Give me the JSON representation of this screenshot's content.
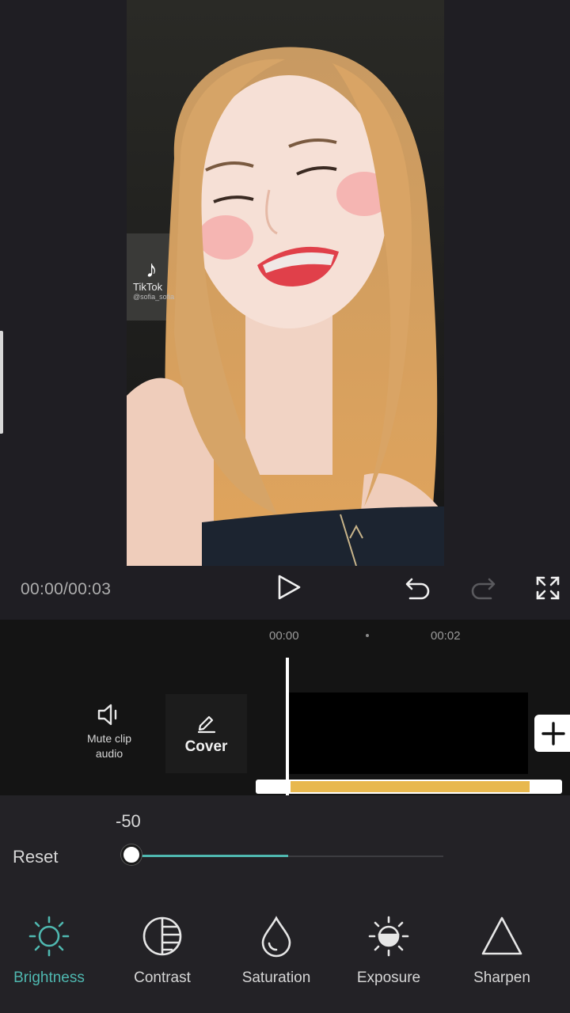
{
  "player": {
    "timecode": "00:00/00:03",
    "watermark_text": "TikTok",
    "watermark_handle": "@sofia_sofia"
  },
  "timeline": {
    "tick_start": "00:00",
    "tick_mid": "00:02",
    "mute_label_line1": "Mute clip",
    "mute_label_line2": "audio",
    "cover_label": "Cover"
  },
  "adjust": {
    "value_label": "-50",
    "reset_label": "Reset",
    "slider": {
      "min": -100,
      "max": 100,
      "value": -50
    },
    "accent_color": "#4fb8b0",
    "tools": [
      {
        "label": "Brightness",
        "icon": "sun-icon",
        "active": true
      },
      {
        "label": "Contrast",
        "icon": "contrast-icon",
        "active": false
      },
      {
        "label": "Saturation",
        "icon": "droplet-icon",
        "active": false
      },
      {
        "label": "Exposure",
        "icon": "exposure-icon",
        "active": false
      },
      {
        "label": "Sharpen",
        "icon": "triangle-icon",
        "active": false
      }
    ]
  }
}
